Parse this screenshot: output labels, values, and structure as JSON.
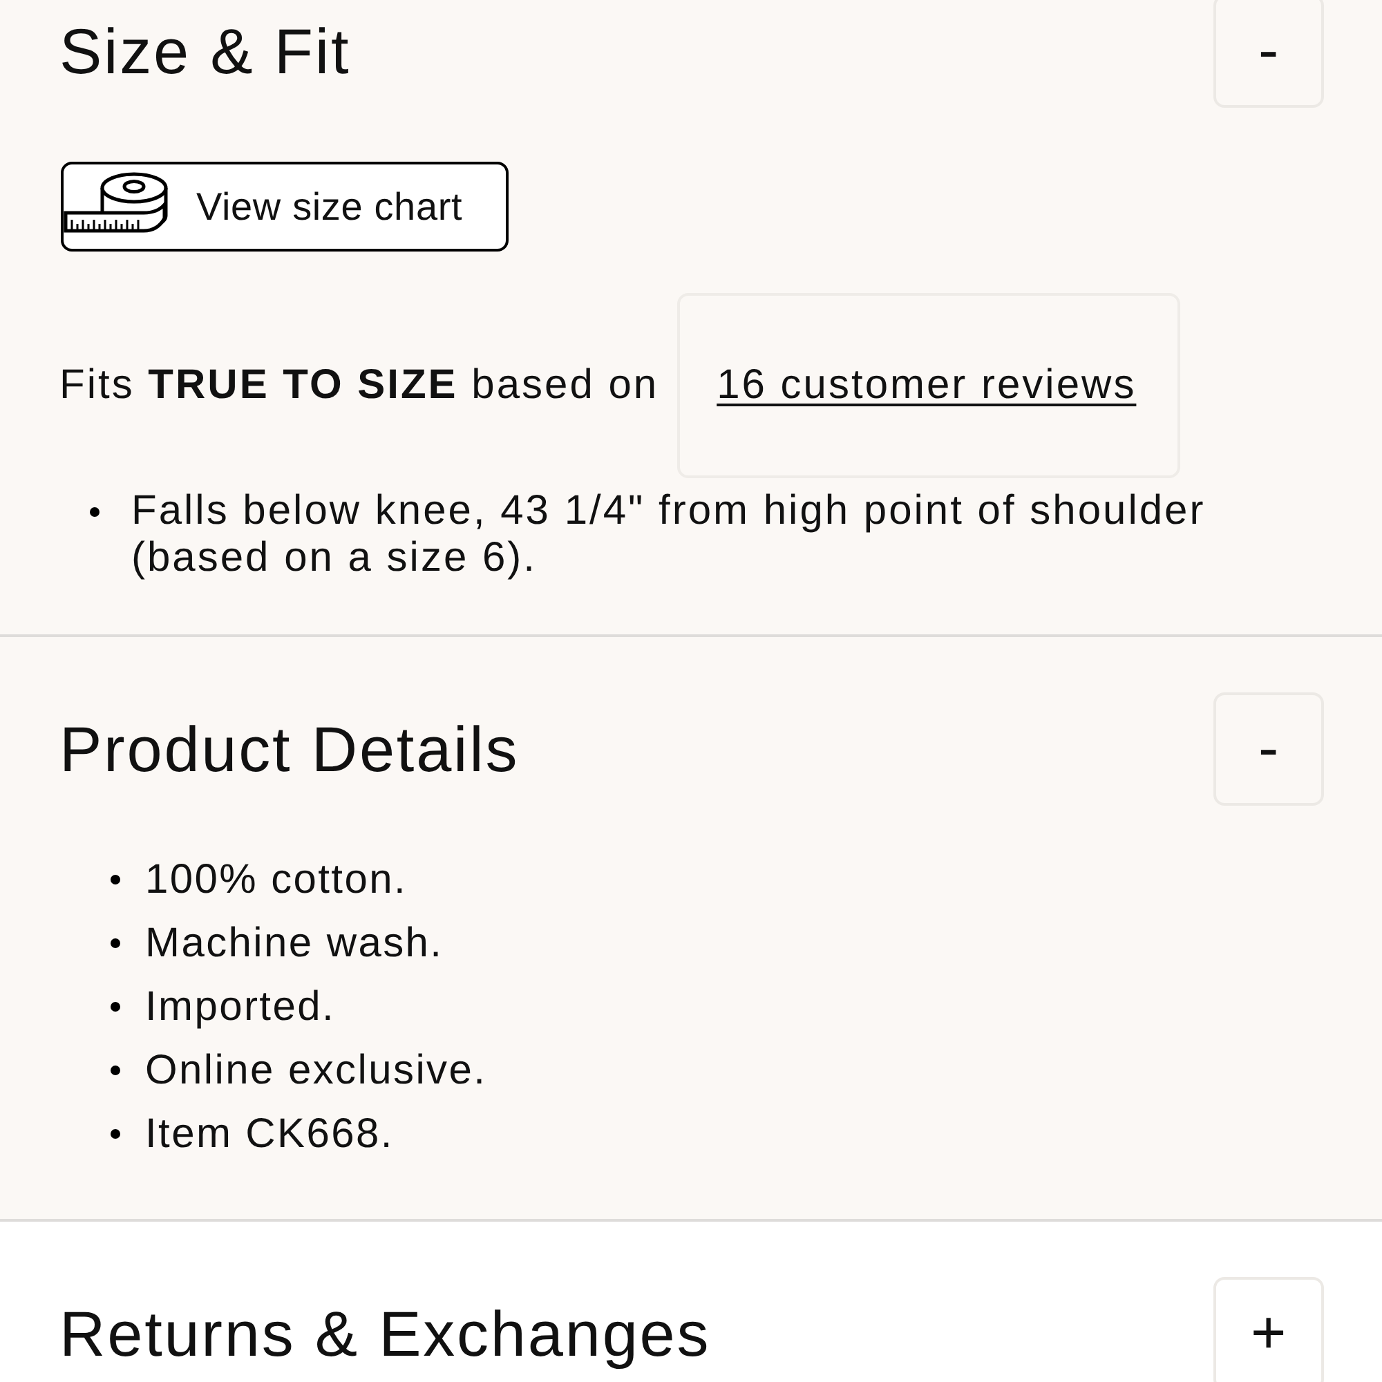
{
  "sections": [
    {
      "title": "Size & Fit",
      "expanded": true,
      "toggle": "-",
      "content": [
        {
          "kind": "button",
          "label": "View size chart"
        },
        {
          "kind": "fit",
          "text": "Fits **TRUE TO SIZE** based on",
          "link": "16 customer reviews"
        },
        {
          "kind": "note",
          "text": "Falls below knee, 43 1/4\" from high point of shoulder (based on a size 6)."
        }
      ]
    },
    {
      "title": "Product Details",
      "expanded": true,
      "toggle": "-",
      "content": [
        {
          "kind": "bullets",
          "items": [
            "100% cotton.",
            "Machine wash.",
            "Imported.",
            "Online exclusive.",
            "Item CK668."
          ]
        }
      ]
    },
    {
      "title": "Returns & Exchanges",
      "expanded": false,
      "toggle": "+"
    }
  ]
}
